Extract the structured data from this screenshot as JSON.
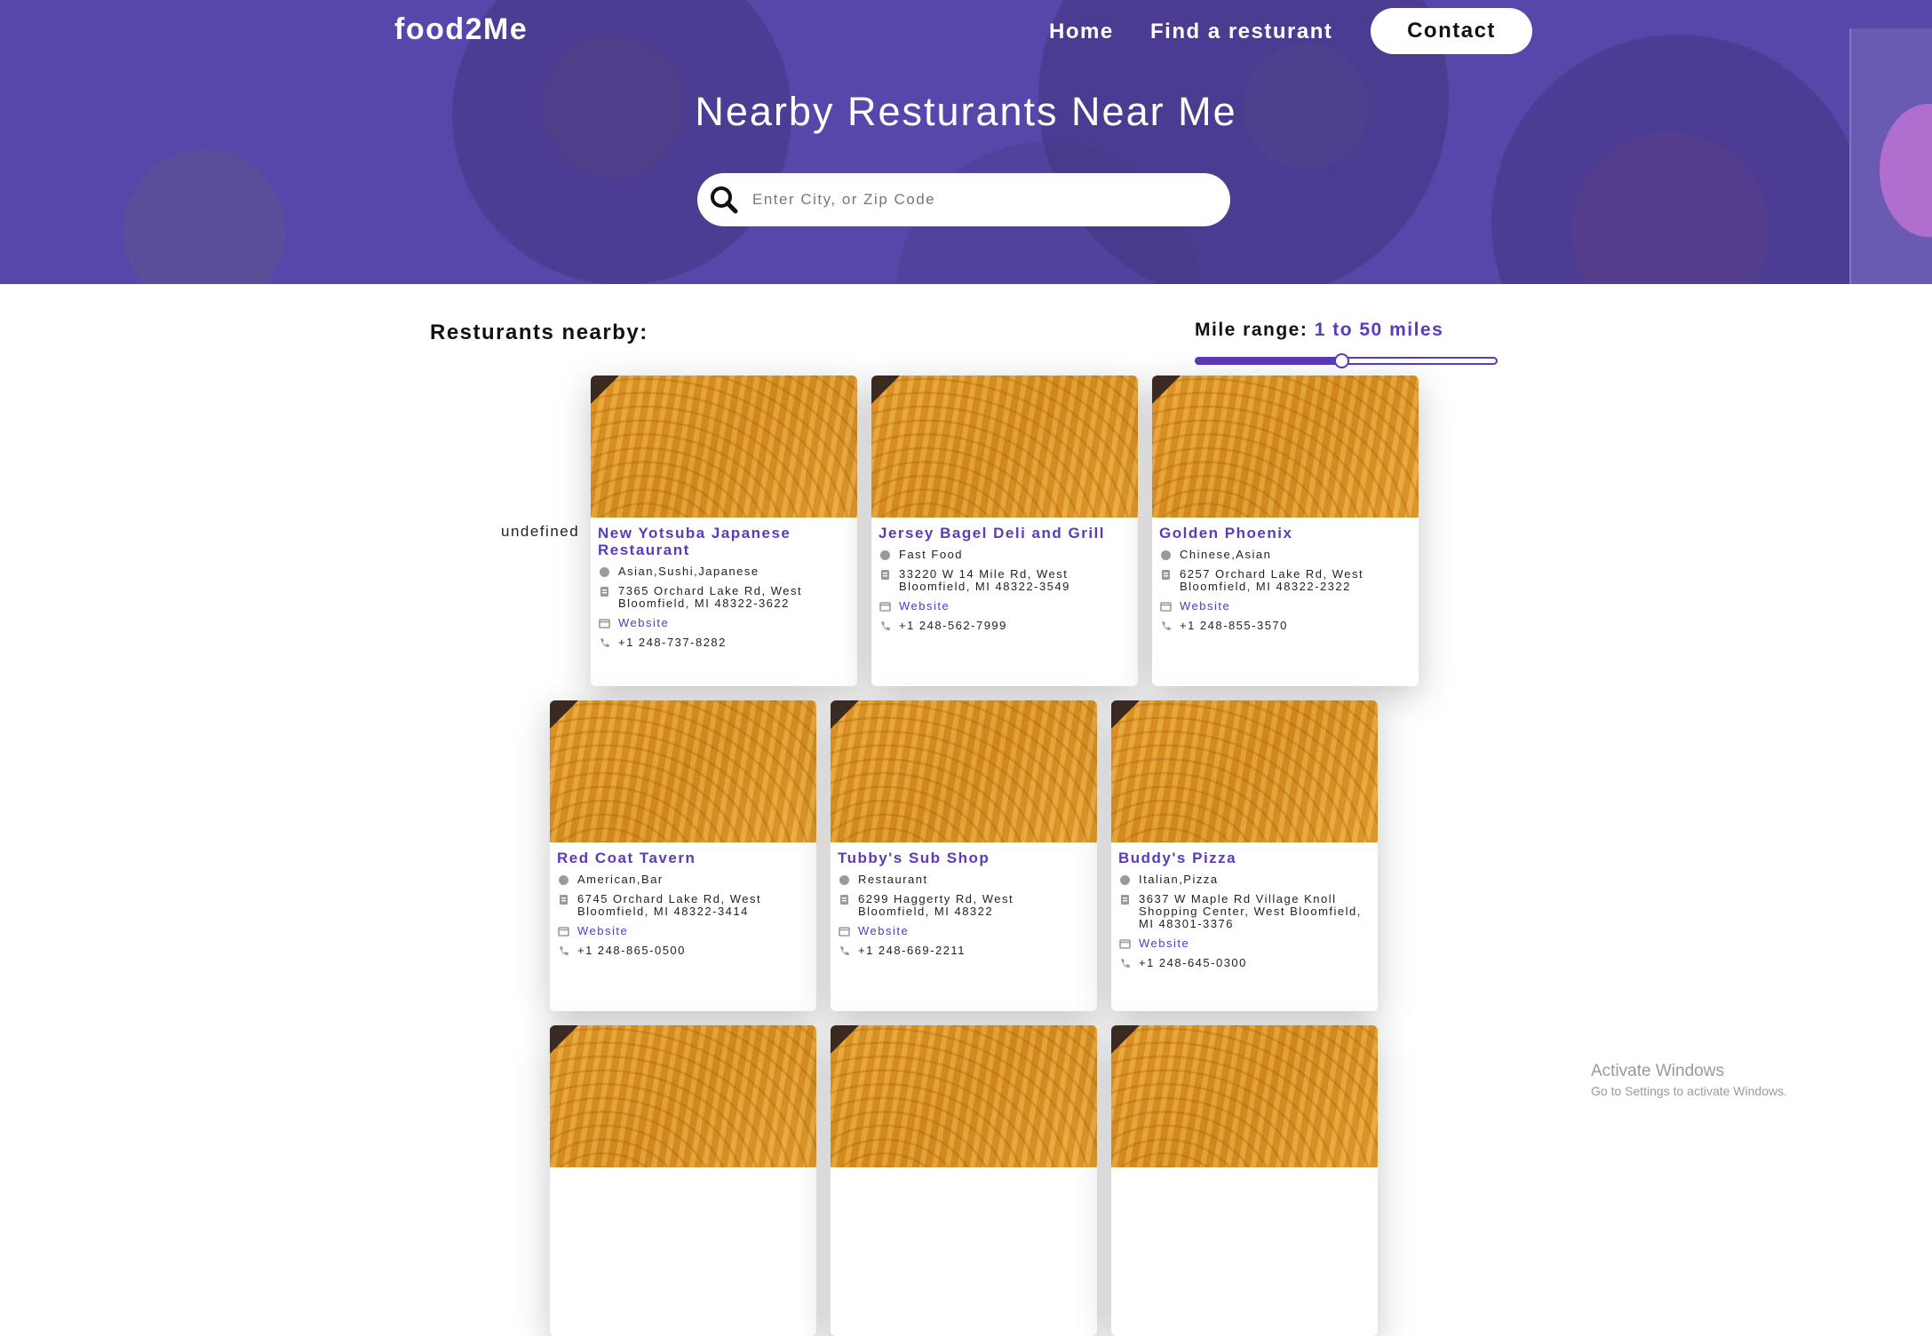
{
  "header": {
    "brand": "food2Me",
    "nav": [
      "Home",
      "Find a resturant",
      "Contact"
    ],
    "title": "Nearby Resturants Near Me",
    "search_placeholder": "Enter City, or Zip Code"
  },
  "section": {
    "title": "Resturants nearby:",
    "range_label": "Mile range:",
    "range_value": "1 to 50 miles",
    "slider": {
      "min": 1,
      "max": 50,
      "value": 25
    },
    "undefined_text": "undefined"
  },
  "restaurants": [
    {
      "name": "New Yotsuba Japanese Restaurant",
      "category": "Asian,Sushi,Japanese",
      "address": "7365 Orchard Lake Rd, West Bloomfield, MI 48322-3622",
      "website": "Website",
      "phone": "+1 248-737-8282"
    },
    {
      "name": "Jersey Bagel Deli and Grill",
      "category": "Fast Food",
      "address": "33220 W 14 Mile Rd, West Bloomfield, MI 48322-3549",
      "website": "Website",
      "phone": "+1 248-562-7999"
    },
    {
      "name": "Golden Phoenix",
      "category": "Chinese,Asian",
      "address": "6257 Orchard Lake Rd, West Bloomfield, MI 48322-2322",
      "website": "Website",
      "phone": "+1 248-855-3570"
    },
    {
      "name": "Red Coat Tavern",
      "category": "American,Bar",
      "address": "6745 Orchard Lake Rd, West Bloomfield, MI 48322-3414",
      "website": "Website",
      "phone": "+1 248-865-0500"
    },
    {
      "name": "Tubby's Sub Shop",
      "category": "Restaurant",
      "address": "6299 Haggerty Rd, West Bloomfield, MI 48322",
      "website": "Website",
      "phone": "+1 248-669-2211"
    },
    {
      "name": "Buddy's Pizza",
      "category": "Italian,Pizza",
      "address": "3637 W Maple Rd Village Knoll Shopping Center, West Bloomfield, MI 48301-3376",
      "website": "Website",
      "phone": "+1 248-645-0300"
    },
    {
      "name": "",
      "category": "",
      "address": "",
      "website": "",
      "phone": ""
    },
    {
      "name": "",
      "category": "",
      "address": "",
      "website": "",
      "phone": ""
    },
    {
      "name": "",
      "category": "",
      "address": "",
      "website": "",
      "phone": ""
    }
  ],
  "watermark": {
    "line1": "Activate Windows",
    "line2": "Go to Settings to activate Windows."
  },
  "colors": {
    "accent": "#5b3bb7",
    "link": "#4a3cc9",
    "hero_tint": "#5846af"
  }
}
